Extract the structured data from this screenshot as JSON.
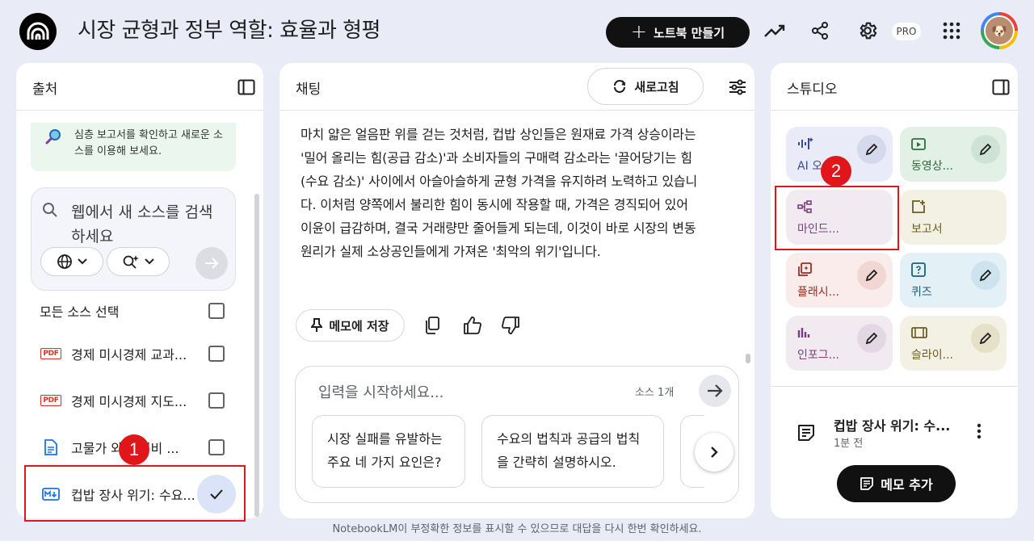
{
  "app": {
    "title": "시장 균형과 정부 역할: 효율과 형평",
    "create_label": "노트북 만들기",
    "pro_label": "PRO"
  },
  "sources": {
    "title": "출처",
    "hint": "심층 보고서를 확인하고 새로운 소스를 이용해 보세요.",
    "search_placeholder": "웹에서 새 소스를 검색하세요",
    "select_all": "모든 소스 선택",
    "items": [
      {
        "type": "pdf",
        "label": "경제 미시경제 교과...",
        "checked": false
      },
      {
        "type": "pdf",
        "label": "경제 미시경제 지도...",
        "checked": false
      },
      {
        "type": "doc",
        "label": "고물가 와 가성비 ...",
        "checked": false
      },
      {
        "type": "md",
        "label": "컵밥 장사 위기: 수요...",
        "checked": true
      }
    ]
  },
  "chat": {
    "title": "채팅",
    "refresh_label": "새로고침",
    "message": "마치 얇은 얼음판 위를 걷는 것처럼, 컵밥 상인들은 원재료 가격 상승이라는 '밀어 올리는 힘(공급 감소)'과 소비자들의 구매력 감소라는 '끌어당기는 힘(수요 감소)' 사이에서 아슬아슬하게 균형 가격을 유지하려 노력하고 있습니다. 이처럼 양쪽에서 불리한 힘이 동시에 작용할 때, 가격은 경직되어 있어 이윤이 급감하며, 결국 거래량만 줄어들게 되는데, 이것이 바로 시장의 변동 원리가 실제 소상공인들에게 가져온 '최악의 위기'입니다.",
    "save_memo_label": "메모에 저장",
    "input_placeholder": "입력을 시작하세요...",
    "source_count": "소스 1개",
    "suggestions": [
      "시장 실패를 유발하는 주요 네 가지 요인은?",
      "수요의 법칙과 공급의 법칙을 간략히 설명하시오."
    ]
  },
  "studio": {
    "title": "스튜디오",
    "tiles": [
      {
        "label": "AI 오...",
        "icon": "audio-wave-icon",
        "bg": "#e9ecf8",
        "fg": "#3c4a8c"
      },
      {
        "label": "동영상...",
        "icon": "video-icon",
        "bg": "#e3f0e6",
        "fg": "#2e6b3f"
      },
      {
        "label": "마인드...",
        "icon": "mindmap-icon",
        "bg": "#f1ebf1",
        "fg": "#7a3f7a"
      },
      {
        "label": "보고서",
        "icon": "report-icon",
        "bg": "#f3f1e4",
        "fg": "#6b5e1f"
      },
      {
        "label": "플래시...",
        "icon": "flashcard-icon",
        "bg": "#f9ecea",
        "fg": "#9b2d24"
      },
      {
        "label": "퀴즈",
        "icon": "quiz-icon",
        "bg": "#e3f1f7",
        "fg": "#1f5f7a"
      },
      {
        "label": "인포그...",
        "icon": "infographic-icon",
        "bg": "#f1ebf1",
        "fg": "#7a3f7a"
      },
      {
        "label": "슬라이...",
        "icon": "slides-icon",
        "bg": "#f3f1e4",
        "fg": "#6b5e1f"
      }
    ],
    "note_title": "컵밥 장사 위기: 수...",
    "note_time": "1분 전",
    "add_memo_label": "메모 추가"
  },
  "annotations": [
    "1",
    "2"
  ],
  "footer": "NotebookLM이 부정확한 정보를 표시할 수 있으므로 대답을 다시 한번 확인하세요."
}
